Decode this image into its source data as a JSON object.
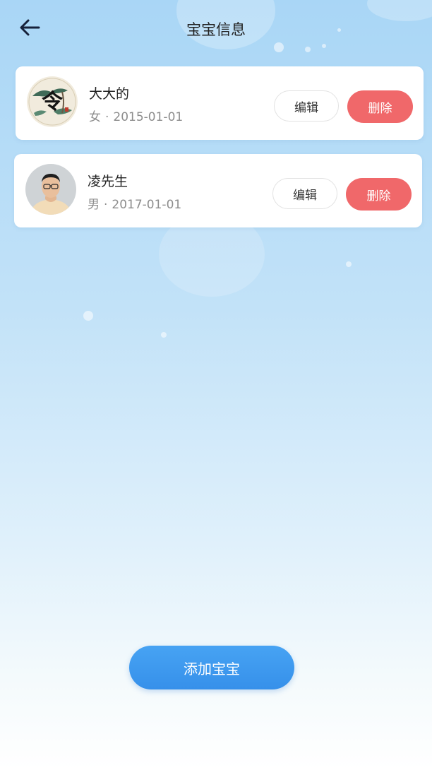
{
  "header": {
    "title": "宝宝信息",
    "back_icon": "back-arrow-icon"
  },
  "babies": [
    {
      "name": "大大的",
      "gender": "女",
      "separator": "·",
      "birthday": "2015-01-01",
      "avatar_glyph": "令",
      "edit_label": "编辑",
      "delete_label": "删除"
    },
    {
      "name": "凌先生",
      "gender": "男",
      "separator": "·",
      "birthday": "2017-01-01",
      "edit_label": "编辑",
      "delete_label": "删除"
    }
  ],
  "add_button": {
    "label": "添加宝宝"
  },
  "colors": {
    "accent": "#3b95ee",
    "danger": "#f0686a",
    "text": "#222222",
    "muted": "#8d8d8d"
  }
}
